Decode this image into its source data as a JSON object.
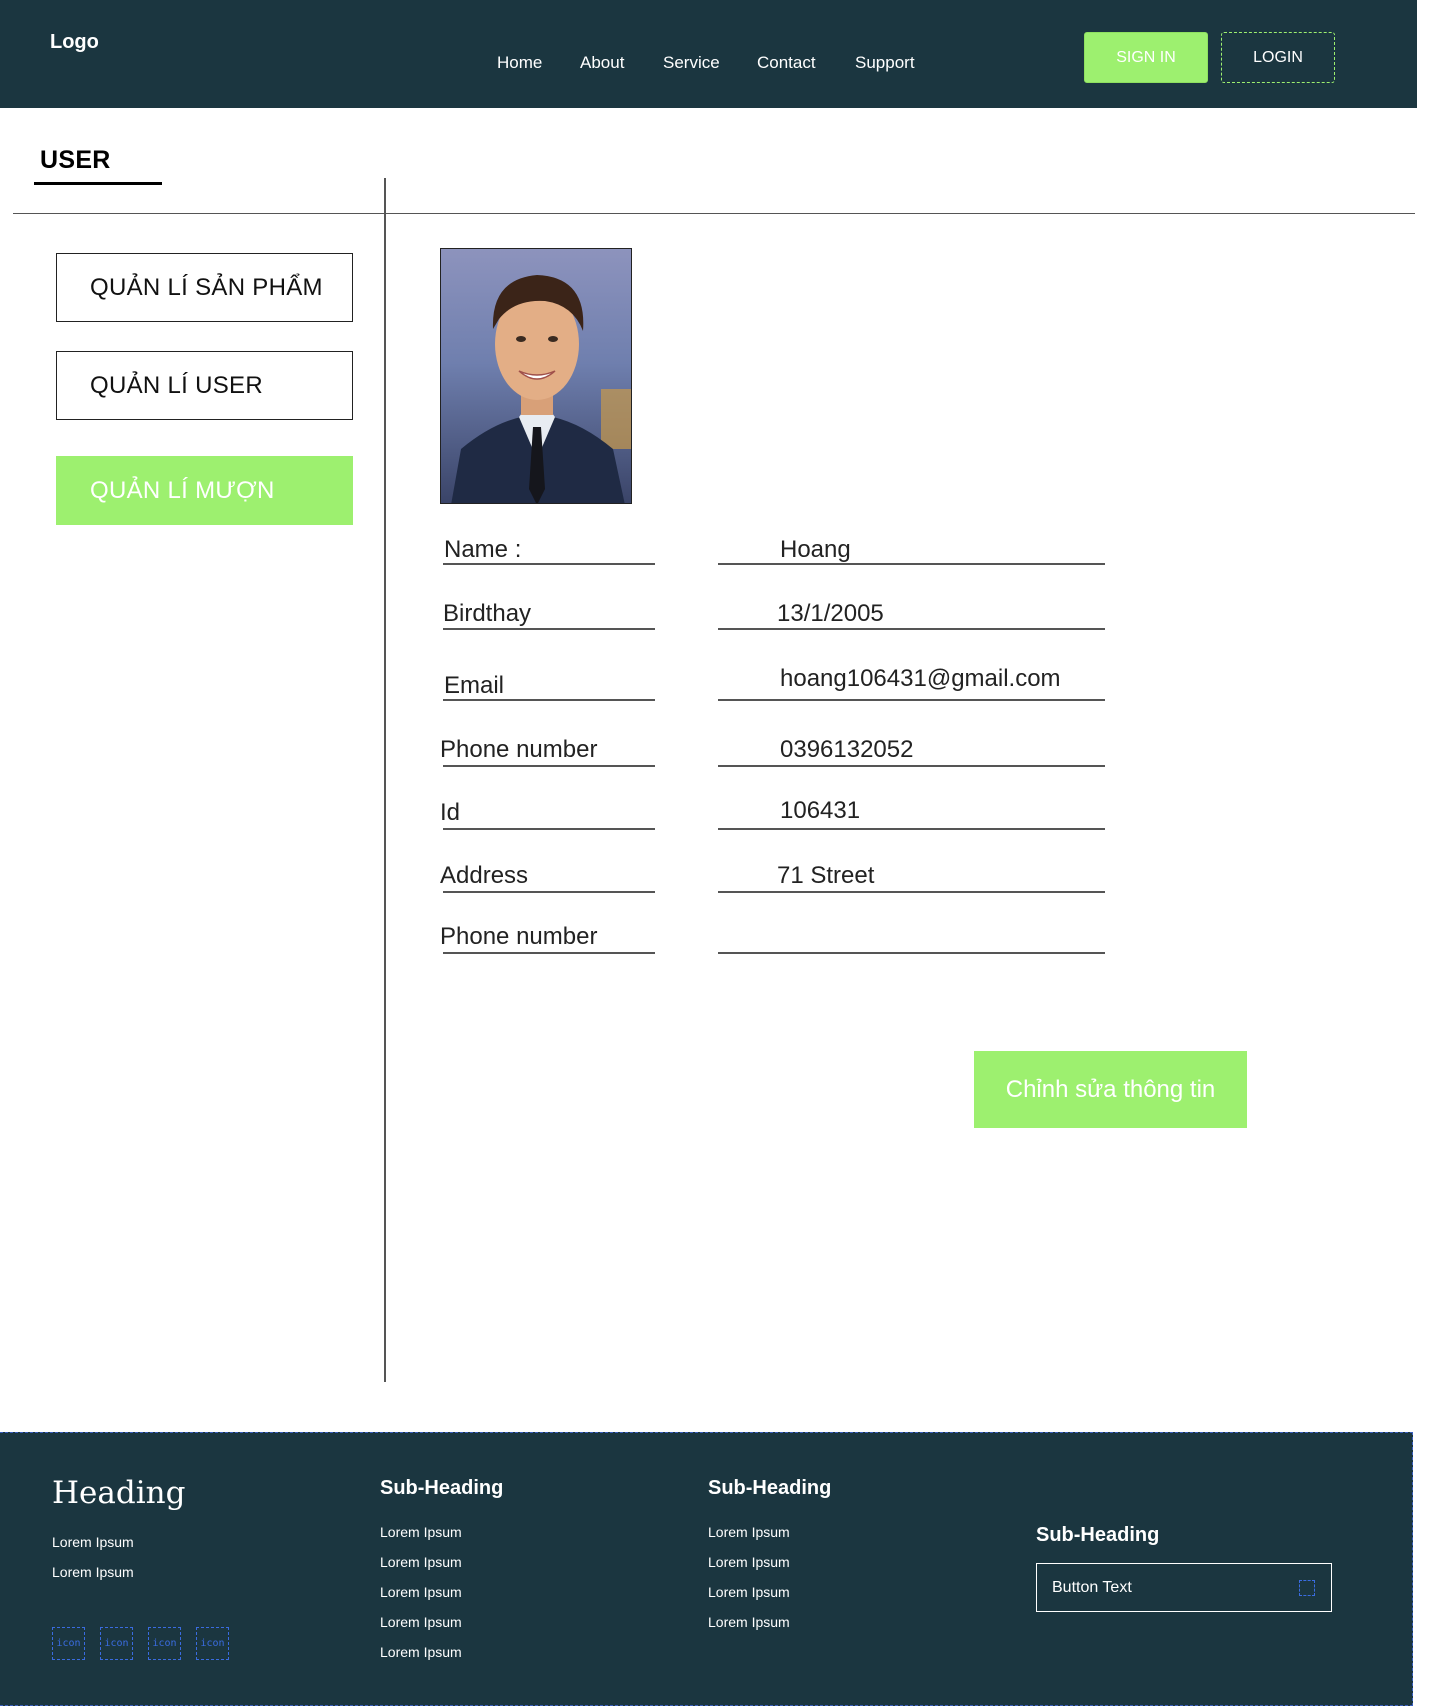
{
  "header": {
    "logo": "Logo",
    "nav": [
      "Home",
      "About",
      "Service",
      "Contact",
      "Support"
    ],
    "sign_in": "SIGN IN",
    "login": "LOGIN"
  },
  "page": {
    "title": "USER"
  },
  "sidebar": {
    "items": [
      {
        "label": "QUẢN LÍ SẢN PHẨM",
        "active": false
      },
      {
        "label": "QUẢN LÍ USER",
        "active": false
      },
      {
        "label": "QUẢN LÍ MƯỢN",
        "active": true
      }
    ]
  },
  "profile": {
    "fields": [
      {
        "label": "Name :",
        "value": "Hoang"
      },
      {
        "label": "Birdthay",
        "value": "13/1/2005"
      },
      {
        "label": "Email",
        "value": "hoang106431@gmail.com"
      },
      {
        "label": "Phone number",
        "value": "0396132052"
      },
      {
        "label": "Id",
        "value": "106431"
      },
      {
        "label": "Address",
        "value": "71 Street"
      },
      {
        "label": "Phone number",
        "value": ""
      }
    ],
    "edit_button": "Chỉnh sửa thông tin"
  },
  "footer": {
    "heading": "Heading",
    "heading_links": [
      "Lorem Ipsum",
      "Lorem Ipsum"
    ],
    "icons": [
      "icon",
      "icon",
      "icon",
      "icon"
    ],
    "col1": {
      "title": "Sub-Heading",
      "links": [
        "Lorem Ipsum",
        "Lorem Ipsum",
        "Lorem Ipsum",
        "Lorem Ipsum",
        "Lorem Ipsum"
      ]
    },
    "col2": {
      "title": "Sub-Heading",
      "links": [
        "Lorem Ipsum",
        "Lorem Ipsum",
        "Lorem Ipsum",
        "Lorem Ipsum"
      ]
    },
    "col3": {
      "title": "Sub-Heading",
      "button_text": "Button Text"
    }
  },
  "colors": {
    "header_bg": "#1b3640",
    "accent": "#9df06f"
  }
}
